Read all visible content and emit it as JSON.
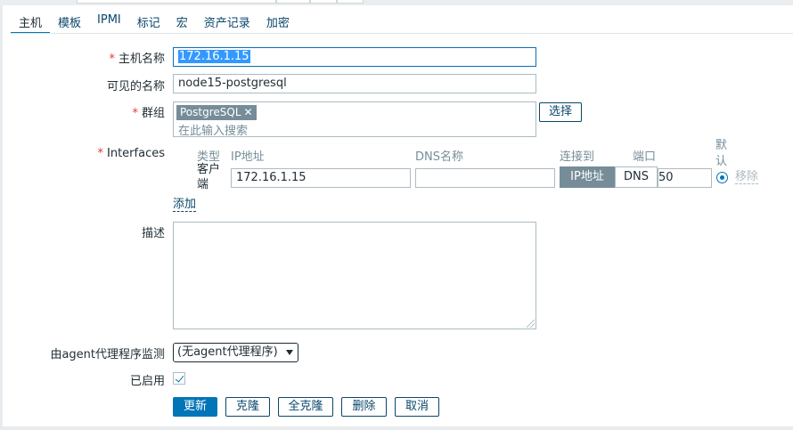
{
  "tabs": [
    {
      "label": "主机",
      "active": true
    },
    {
      "label": "模板"
    },
    {
      "label": "IPMI"
    },
    {
      "label": "标记"
    },
    {
      "label": "宏"
    },
    {
      "label": "资产记录"
    },
    {
      "label": "加密"
    }
  ],
  "form": {
    "host_name": {
      "label": "主机名称",
      "value": "172.16.1.15"
    },
    "visible_name": {
      "label": "可见的名称",
      "value": "node15-postgresql"
    },
    "groups": {
      "label": "群组",
      "tag": "PostgreSQL",
      "placeholder": "在此输入搜索",
      "select_button": "选择"
    },
    "interfaces": {
      "label": "Interfaces",
      "headers": {
        "type": "类型",
        "ip": "IP地址",
        "dns": "DNS名称",
        "connect_to": "连接到",
        "port": "端口",
        "default": "默认"
      },
      "rows": [
        {
          "type": "客户端",
          "ip": "172.16.1.15",
          "dns": "",
          "connect_ip": "IP地址",
          "connect_dns": "DNS",
          "port": "50",
          "remove": "移除"
        }
      ],
      "add_link": "添加"
    },
    "description": {
      "label": "描述",
      "value": ""
    },
    "proxy": {
      "label": "由agent代理程序监测",
      "value": "(无agent代理程序)"
    },
    "enabled": {
      "label": "已启用",
      "checked": true
    }
  },
  "buttons": {
    "update": "更新",
    "clone": "克隆",
    "full_clone": "全克隆",
    "delete": "删除",
    "cancel": "取消"
  },
  "colors": {
    "accent": "#0275b8",
    "link": "#0a466a",
    "required": "#e33734",
    "tag_bg": "#768d99"
  }
}
